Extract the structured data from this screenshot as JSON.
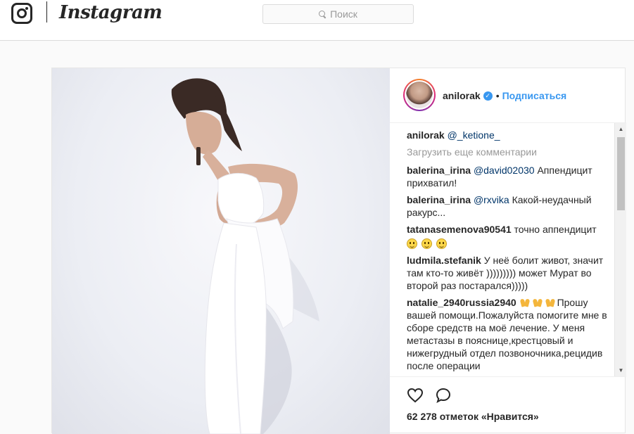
{
  "app": {
    "name": "Instagram"
  },
  "search": {
    "placeholder": "Поиск"
  },
  "post": {
    "author": "anilorak",
    "follow_label": "Подписаться",
    "bullet": "•",
    "caption_user": "anilorak",
    "caption_mention": "@_ketione_",
    "load_more": "Загрузить еще комментарии",
    "comments": [
      {
        "user": "balerina_irina",
        "mention": "@david02030",
        "text": " Аппендицит прихватил!"
      },
      {
        "user": "balerina_irina",
        "mention": "@rxvika",
        "text": " Какой-неудачный ракурс..."
      },
      {
        "user": "tatanasemenova90541",
        "mention": "",
        "text": " точно аппендицит"
      },
      {
        "user": "ludmila.stefanik",
        "mention": "",
        "text": " У неё болит живот, значит там кто-то живёт ))))))))) может Мурат во второй раз постарался)))))"
      },
      {
        "user": "natalie_2940russia2940",
        "mention": "",
        "text": "Прошу вашей помощи.Пожалуйста помогите мне в сборе средств на моё лечение. У меня метастазы в пояснице,крестцовый и нижегрудный отдел позвоночника,рецидив после операции"
      }
    ],
    "likes_text": "62 278 отметок «Нравится»"
  },
  "icons": {
    "logo": "instagram-camera-icon",
    "search": "search-icon",
    "verified": "verified-badge-icon",
    "like": "heart-icon",
    "comment": "comment-bubble-icon",
    "emoji_smile": "grinning-face-icon",
    "emoji_pray": "folded-hands-icon"
  },
  "colors": {
    "link": "#3897f0",
    "text": "#262626",
    "muted": "#999999",
    "background": "#fafafa",
    "border": "#dbdbdb"
  }
}
